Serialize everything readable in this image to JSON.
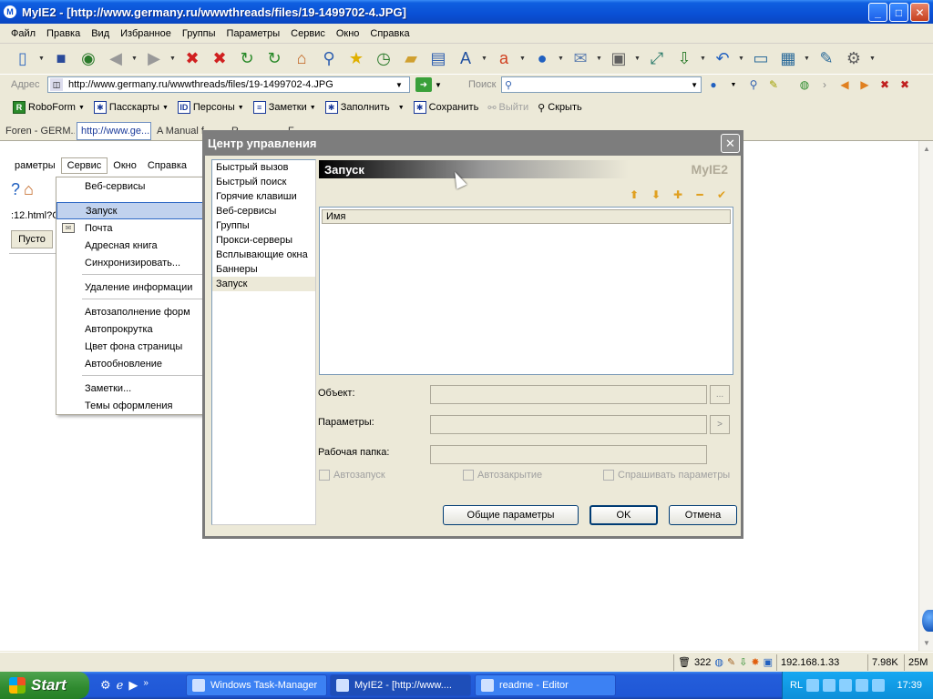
{
  "window": {
    "title": "MyIE2 - [http://www.germany.ru/wwwthreads/files/19-1499702-4.JPG]",
    "app_icon": "M",
    "minimize": "_",
    "maximize": "□",
    "close": "✕"
  },
  "menubar": [
    "Файл",
    "Правка",
    "Вид",
    "Избранное",
    "Группы",
    "Параметры",
    "Сервис",
    "Окно",
    "Справка"
  ],
  "address": {
    "label": "Адрес",
    "url": "http://www.germany.ru/wwwthreads/files/19-1499702-4.JPG",
    "search_label": "Поиск",
    "search_value": ""
  },
  "robobar": {
    "roboform": "RoboForm",
    "passcards": "Пасскарты",
    "identities": "Персоны",
    "notes": "Заметки",
    "fill": "Заполнить",
    "save": "Сохранить",
    "logout": "Выйти",
    "hide": "Скрыть"
  },
  "tabs": [
    "Foren - GERM...",
    "http://www.ge...",
    "A Manual f...",
    "R ",
    "F "
  ],
  "inner": {
    "menu": [
      "раметры",
      "Сервис",
      "Окно",
      "Справка"
    ],
    "addr_text": ":12.html?C",
    "empty_btn": "Пусто"
  },
  "service_menu": {
    "items": [
      "Веб-сервисы",
      "Запуск",
      "Почта",
      "Адресная книга",
      "Синхронизировать...",
      "Удаление информации",
      "Автозаполнение форм",
      "Автопрокрутка",
      "Цвет фона страницы",
      "Автообновление",
      "Заметки...",
      "Темы оформления"
    ],
    "highlighted": "Запуск"
  },
  "dialog": {
    "title": "Центр управления",
    "nav": [
      "Быстрый вызов",
      "Быстрый поиск",
      "Горячие клавиши",
      "Веб-сервисы",
      "Группы",
      "Прокси-серверы",
      "Всплывающие окна",
      "Баннеры",
      "Запуск"
    ],
    "selected_nav": "Запуск",
    "header": "Запуск",
    "brand": "MyIE2",
    "list_column": "Имя",
    "fields": {
      "object_label": "Объект:",
      "object_value": "",
      "params_label": "Параметры:",
      "params_value": "",
      "folder_label": "Рабочая папка:",
      "folder_value": ""
    },
    "browse_btn": "...",
    "params_btn": ">",
    "checkboxes": {
      "autostart": "Автозапуск",
      "autoclose": "Автозакрытие",
      "ask_params": "Спрашивать параметры"
    },
    "buttons": {
      "general": "Общие параметры",
      "ok": "OK",
      "cancel": "Отмена"
    }
  },
  "statusbar": {
    "count": "322",
    "ip": "192.168.1.33",
    "size1": "7.98K",
    "size2": "25M"
  },
  "taskbar": {
    "start": "Start",
    "items": [
      "Windows Task-Manager",
      "MyIE2 - [http://www....",
      "readme - Editor"
    ],
    "active_item": "MyIE2 - [http://www....",
    "tray_lang": "RL",
    "clock": "17:39"
  },
  "colors": {
    "titlebar": "#0a50d5",
    "taskbar": "#245edb",
    "start": "#2f8a2f",
    "dialog_title_inactive": "#7d7d7d",
    "menu_highlight": "#c1d2ee"
  }
}
